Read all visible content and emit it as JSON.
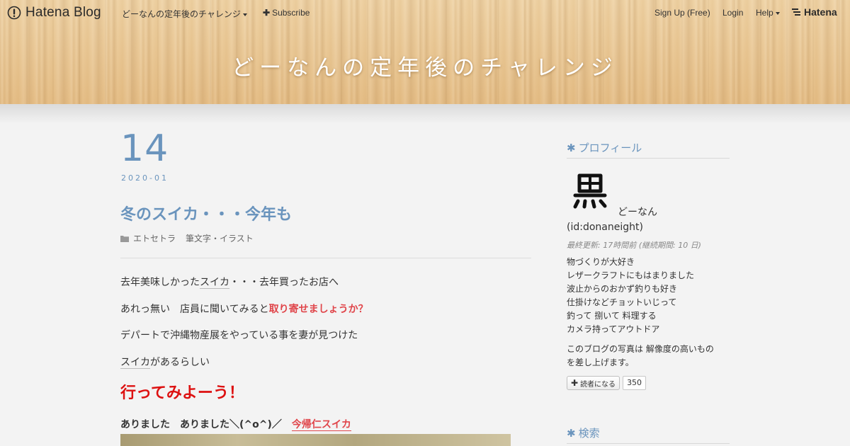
{
  "global_header": {
    "logo_text": "Hatena Blog",
    "blog_menu_label": "どーなんの定年後のチャレンジ",
    "subscribe_label": "Subscribe",
    "signup_label": "Sign Up (Free)",
    "login_label": "Login",
    "help_label": "Help",
    "hatena_label": "Hatena"
  },
  "blog": {
    "title": "どーなんの定年後のチャレンジ"
  },
  "entry": {
    "date_day": "14",
    "date_year_month": "2020-01",
    "title": "冬のスイカ・・・今年も",
    "categories": [
      "エトセトラ",
      "筆文字・イラスト"
    ],
    "p1_a": "去年美味しかった",
    "p1_kw": "スイカ",
    "p1_b": "・・・去年買ったお店へ",
    "p2_a": "あれっ無い　店員に聞いてみると",
    "p2_red": "取り寄せましょうか？",
    "p3": "デパートで沖縄物産展をやっている事を妻が見つけた",
    "p4_kw": "スイカ",
    "p4_b": "があるらしい",
    "big_text": "行ってみよーう！",
    "bold_line": "ありました　ありました＼(^o^)／",
    "bold_link": "今帰仁スイカ"
  },
  "sidebar": {
    "profile_heading": "プロフィール",
    "profile_name": "どーなん",
    "profile_id": "(id:donaneight)",
    "profile_updated": "最終更新: 17時間前 (継続期間: 10 日)",
    "profile_desc": [
      "物づくりが大好き",
      "レザークラフトにもはまりました",
      "波止からのおかず釣りも好き",
      "仕掛けなどチョットいじって",
      "釣って 捌いて 料理する",
      "カメラ持ってアウトドア"
    ],
    "profile_note_1": "このブログの写真は 解像度の高いもの",
    "profile_note_2": "を差し上げます。",
    "reader_label": "読者になる",
    "reader_count": "350",
    "search_heading": "検索"
  },
  "colors": {
    "accent": "#6a94bd",
    "red_link": "#e0454a",
    "big_red": "#dd1111"
  }
}
